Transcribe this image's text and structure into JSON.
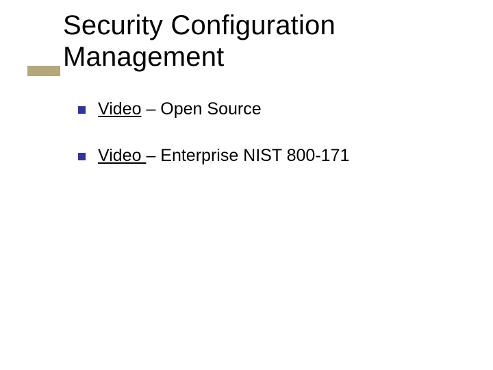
{
  "colors": {
    "accent_bar": "#b3a77b",
    "bullet_square": "#33339a"
  },
  "slide": {
    "title": "Security Configuration Management",
    "bullets": [
      {
        "link_text": "Video",
        "rest_text": " – Open Source"
      },
      {
        "link_text": "Video ",
        "rest_text": "– Enterprise NIST 800-171"
      }
    ]
  }
}
